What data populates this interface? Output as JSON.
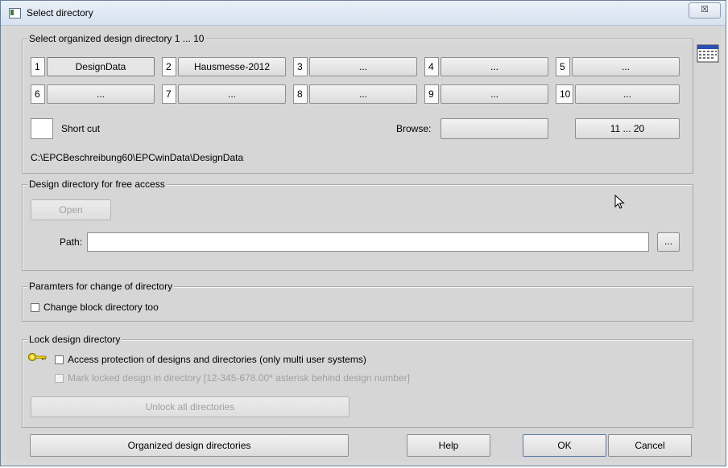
{
  "window": {
    "title": "Select directory",
    "close_glyph": "☒"
  },
  "organized": {
    "legend": "Select organized design directory   1 ... 10",
    "slots": [
      {
        "num": "1",
        "label": "DesignData"
      },
      {
        "num": "2",
        "label": "Hausmesse-2012"
      },
      {
        "num": "3",
        "label": "..."
      },
      {
        "num": "4",
        "label": "..."
      },
      {
        "num": "5",
        "label": "..."
      },
      {
        "num": "6",
        "label": "..."
      },
      {
        "num": "7",
        "label": "..."
      },
      {
        "num": "8",
        "label": "..."
      },
      {
        "num": "9",
        "label": "..."
      },
      {
        "num": "10",
        "label": "..."
      }
    ],
    "shortcut_label": "Short cut",
    "browse_label": "Browse:",
    "range_button": "11 ... 20",
    "current_path": "C:\\EPCBeschreibung60\\EPCwinData\\DesignData"
  },
  "free_access": {
    "legend": "Design directory for free access",
    "open_button": "Open",
    "path_label": "Path:",
    "path_value": "",
    "browse_button": "..."
  },
  "params": {
    "legend": "Paramters for change of directory",
    "change_block_label": "Change block directory too"
  },
  "lock": {
    "legend": "Lock design directory",
    "access_protection_label": "Access protection of designs and directories (only multi user systems)",
    "mark_locked_label": "Mark locked design in directory [12-345-678.00* asterisk behind design number]",
    "unlock_button": "Unlock all directories"
  },
  "footer": {
    "organized_button": "Organized design directories",
    "help_button": "Help",
    "ok_button": "OK",
    "cancel_button": "Cancel"
  },
  "icons": {
    "side": "calendar-grid-icon",
    "key": "key-icon",
    "cursor": "mouse-pointer-icon"
  },
  "colors": {
    "key": "#d4b000",
    "calendar_accent": "#2a4fb0"
  }
}
